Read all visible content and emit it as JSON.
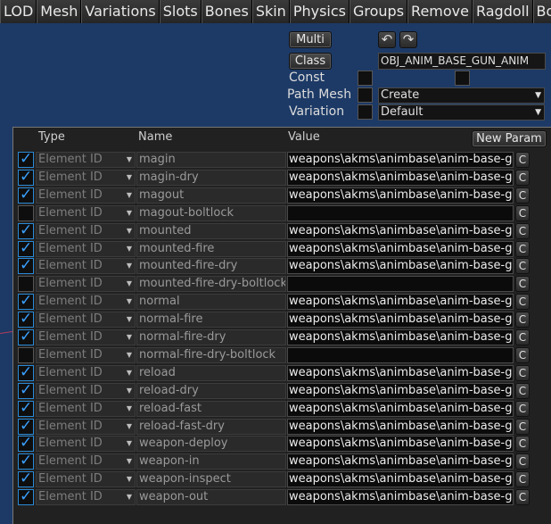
{
  "menu": {
    "tabs": [
      "LOD",
      "Mesh",
      "Variations",
      "Slots",
      "Bones",
      "Skin",
      "Physics",
      "Groups",
      "Remove",
      "Ragdoll",
      "Body"
    ]
  },
  "props": {
    "multi_label": "Multi",
    "class_label": "Class",
    "class_value": "OBJ_ANIM_BASE_GUN_ANIM",
    "const_label": "Const",
    "path_mesh_label": "Path Mesh",
    "path_mesh_value": "Create",
    "variation_label": "Variation",
    "variation_value": "Default",
    "undo_icon": "undo-icon",
    "redo_icon": "redo-icon"
  },
  "params": {
    "headers": {
      "type": "Type",
      "name": "Name",
      "value": "Value"
    },
    "new_param_label": "New Param",
    "c_label": "C",
    "rows": [
      {
        "checked": true,
        "type": "Element ID",
        "name": "magin",
        "value": "weapons\\akms\\animbase\\anim-base-gun\\"
      },
      {
        "checked": true,
        "type": "Element ID",
        "name": "magin-dry",
        "value": "weapons\\akms\\animbase\\anim-base-gun\\"
      },
      {
        "checked": true,
        "type": "Element ID",
        "name": "magout",
        "value": "weapons\\akms\\animbase\\anim-base-gun\\"
      },
      {
        "checked": false,
        "type": "Element ID",
        "name": "magout-boltlock",
        "value": ""
      },
      {
        "checked": true,
        "type": "Element ID",
        "name": "mounted",
        "value": "weapons\\akms\\animbase\\anim-base-gun\\"
      },
      {
        "checked": true,
        "type": "Element ID",
        "name": "mounted-fire",
        "value": "weapons\\akms\\animbase\\anim-base-gun\\"
      },
      {
        "checked": true,
        "type": "Element ID",
        "name": "mounted-fire-dry",
        "value": "weapons\\akms\\animbase\\anim-base-gun\\"
      },
      {
        "checked": false,
        "type": "Element ID",
        "name": "mounted-fire-dry-boltlock",
        "value": ""
      },
      {
        "checked": true,
        "type": "Element ID",
        "name": "normal",
        "value": "weapons\\akms\\animbase\\anim-base-gun\\"
      },
      {
        "checked": true,
        "type": "Element ID",
        "name": "normal-fire",
        "value": "weapons\\akms\\animbase\\anim-base-gun\\"
      },
      {
        "checked": true,
        "type": "Element ID",
        "name": "normal-fire-dry",
        "value": "weapons\\akms\\animbase\\anim-base-gun\\"
      },
      {
        "checked": false,
        "type": "Element ID",
        "name": "normal-fire-dry-boltlock",
        "value": ""
      },
      {
        "checked": true,
        "type": "Element ID",
        "name": "reload",
        "value": "weapons\\akms\\animbase\\anim-base-gun\\"
      },
      {
        "checked": true,
        "type": "Element ID",
        "name": "reload-dry",
        "value": "weapons\\akms\\animbase\\anim-base-gun\\"
      },
      {
        "checked": true,
        "type": "Element ID",
        "name": "reload-fast",
        "value": "weapons\\akms\\animbase\\anim-base-gun\\"
      },
      {
        "checked": true,
        "type": "Element ID",
        "name": "reload-fast-dry",
        "value": "weapons\\akms\\animbase\\anim-base-gun\\"
      },
      {
        "checked": true,
        "type": "Element ID",
        "name": "weapon-deploy",
        "value": "weapons\\akms\\animbase\\anim-base-gun\\"
      },
      {
        "checked": true,
        "type": "Element ID",
        "name": "weapon-in",
        "value": "weapons\\akms\\animbase\\anim-base-gun\\"
      },
      {
        "checked": true,
        "type": "Element ID",
        "name": "weapon-inspect",
        "value": "weapons\\akms\\animbase\\anim-base-gun\\"
      },
      {
        "checked": true,
        "type": "Element ID",
        "name": "weapon-out",
        "value": "weapons\\akms\\animbase\\anim-base-gun\\"
      }
    ]
  },
  "colors": {
    "background": "#1d3a66",
    "panel": "#212121",
    "check_accent": "#3aa0ff"
  }
}
